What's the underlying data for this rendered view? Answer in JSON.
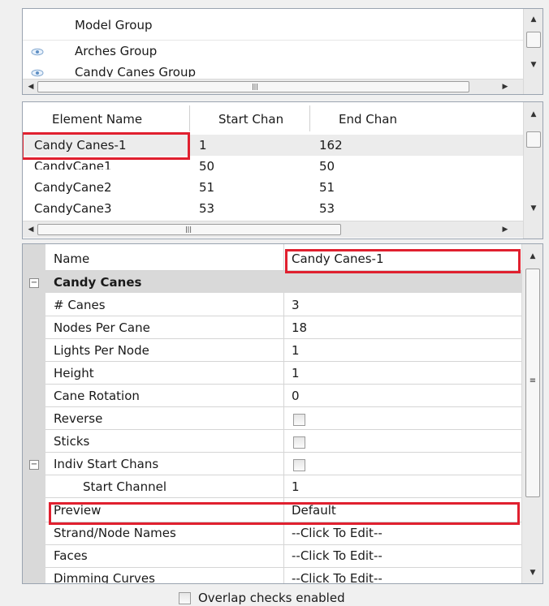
{
  "model_groups": {
    "header": "Model Group",
    "items": [
      {
        "label": "Arches Group",
        "icon": "eye-icon"
      },
      {
        "label": "Candy Canes Group",
        "icon": "eye-icon"
      }
    ]
  },
  "elements": {
    "columns": [
      "Element Name",
      "Start Chan",
      "End Chan"
    ],
    "rows": [
      [
        "Candy Canes-1",
        "1",
        "162"
      ],
      [
        "CandyCane1",
        "50",
        "50"
      ],
      [
        "CandyCane2",
        "51",
        "51"
      ],
      [
        "CandyCane3",
        "53",
        "53"
      ]
    ]
  },
  "properties": {
    "name_label": "Name",
    "name_value": "Candy Canes-1",
    "category": "Candy Canes",
    "rows": [
      {
        "label": "# Canes",
        "value": "3"
      },
      {
        "label": "Nodes Per Cane",
        "value": "18"
      },
      {
        "label": "Lights Per Node",
        "value": "1"
      },
      {
        "label": "Height",
        "value": "1"
      },
      {
        "label": "Cane Rotation",
        "value": "0"
      },
      {
        "label": "Reverse",
        "value": ""
      },
      {
        "label": "Sticks",
        "value": ""
      },
      {
        "label": "Indiv Start Chans",
        "value": ""
      },
      {
        "label": "Start Channel",
        "value": "1"
      },
      {
        "label": "Preview",
        "value": "Default"
      },
      {
        "label": "Strand/Node Names",
        "value": "--Click To Edit--"
      },
      {
        "label": "Faces",
        "value": "--Click To Edit--"
      },
      {
        "label": "Dimming Curves",
        "value": "--Click To Edit--"
      }
    ]
  },
  "footer": {
    "overlap_label": "Overlap checks enabled"
  },
  "colors": {
    "highlight": "#e0202f",
    "border": "#9aa4b0"
  }
}
